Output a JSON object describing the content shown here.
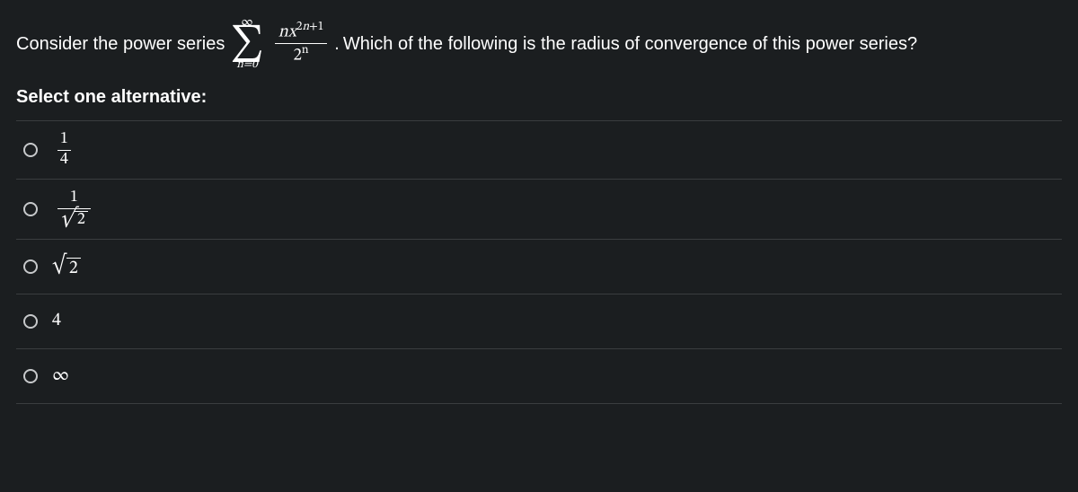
{
  "question": {
    "lead_text": "Consider the power series",
    "sum_top": "∞",
    "sum_bottom_lhs": "n",
    "sum_bottom_eq": "=",
    "sum_bottom_rhs": "0",
    "frac_num_n": "n",
    "frac_num_x": "x",
    "frac_num_exp_a": "2",
    "frac_num_exp_n": "n",
    "frac_num_exp_plus": "+",
    "frac_num_exp_b": "1",
    "frac_den_base": "2",
    "frac_den_exp": "n",
    "period": ".",
    "tail_text": "Which of the following is the radius of convergence of this power series?"
  },
  "prompt2": "Select one alternative:",
  "options": [
    {
      "type": "frac",
      "num": "1",
      "den": "4"
    },
    {
      "type": "frac_sqrt_den",
      "num": "1",
      "rad": "2"
    },
    {
      "type": "sqrt",
      "rad": "2"
    },
    {
      "type": "plain",
      "text": "4"
    },
    {
      "type": "plain",
      "text": "∞"
    }
  ]
}
